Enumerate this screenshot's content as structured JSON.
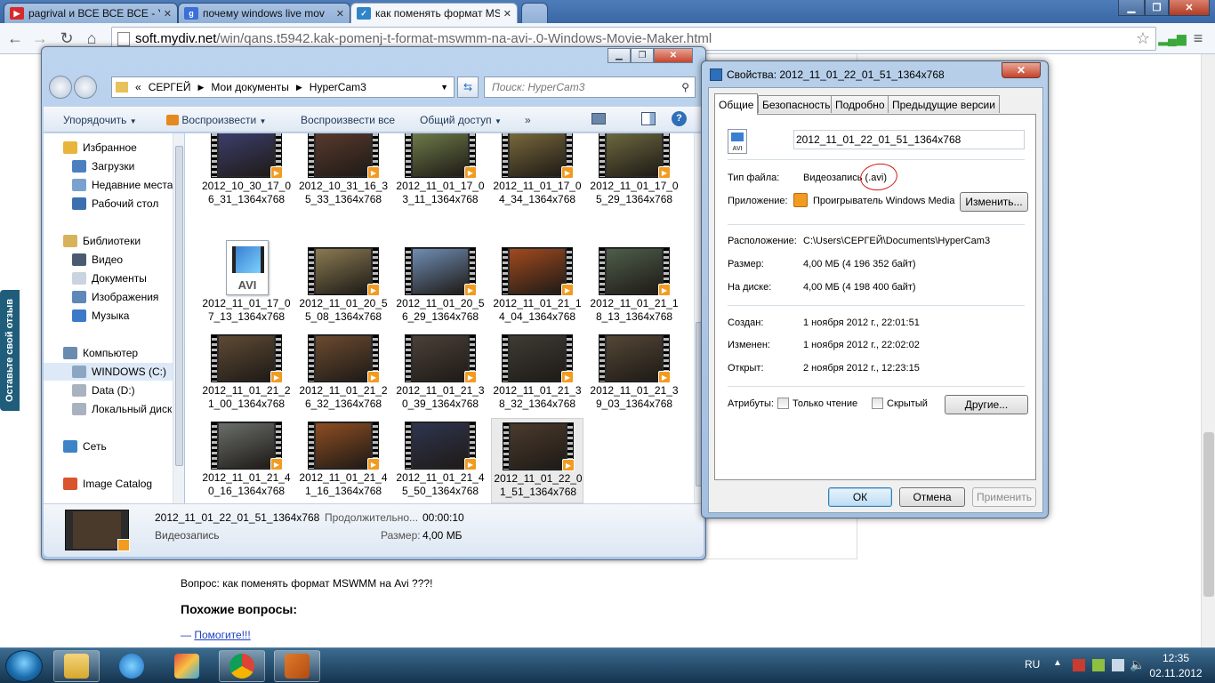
{
  "browser": {
    "tabs": [
      {
        "title": "pagrival и ВСЕ ВСЕ ВСЕ - Y",
        "icon": "youtube-icon"
      },
      {
        "title": "почему windows live mov",
        "icon": "google-icon"
      },
      {
        "title": "как поменять формат MS",
        "icon": "page-icon"
      }
    ],
    "url_host": "soft.mydiv.net",
    "url_path": "/win/qans.t5942.kak-pomenj-t-format-mswmm-na-avi-.0-Windows-Movie-Maker.html"
  },
  "webpage": {
    "feedback_tab": "Оставьте свой отзыв",
    "question": "Вопрос: как поменять формат MSWMM на Avi ???!",
    "similar_heading": "Похожие вопросы:",
    "similar_dash": "—",
    "similar_link": "Помогите!!!"
  },
  "explorer": {
    "breadcrumb": [
      "«",
      "СЕРГЕЙ",
      "Мои документы",
      "HyperCam3"
    ],
    "search_placeholder": "Поиск: HyperCam3",
    "commands": {
      "organize": "Упорядочить",
      "play": "Воспроизвести",
      "play_all": "Воспроизвести все",
      "share": "Общий доступ",
      "more": "»"
    },
    "nav": [
      {
        "label": "Избранное",
        "icon": "star-icon",
        "color": "#e8b43a",
        "level": 0
      },
      {
        "label": "Загрузки",
        "icon": "downloads-icon",
        "color": "#4b7fc0",
        "level": 1
      },
      {
        "label": "Недавние места",
        "icon": "recent-places-icon",
        "color": "#7aa2cf",
        "level": 1
      },
      {
        "label": "Рабочий стол",
        "icon": "desktop-icon",
        "color": "#3b6fb0",
        "level": 1
      },
      {
        "label": "Библиотеки",
        "icon": "libraries-icon",
        "color": "#d8b25a",
        "level": 0
      },
      {
        "label": "Видео",
        "icon": "video-library-icon",
        "color": "#4a5a70",
        "level": 1
      },
      {
        "label": "Документы",
        "icon": "documents-library-icon",
        "color": "#c9d4df",
        "level": 1
      },
      {
        "label": "Изображения",
        "icon": "pictures-library-icon",
        "color": "#5d88b8",
        "level": 1
      },
      {
        "label": "Музыка",
        "icon": "music-library-icon",
        "color": "#3c7ac9",
        "level": 1
      },
      {
        "label": "Компьютер",
        "icon": "computer-icon",
        "color": "#6a8bb0",
        "level": 0
      },
      {
        "label": "WINDOWS (C:)",
        "icon": "drive-c-icon",
        "color": "#8aa6c2",
        "level": 1,
        "selected": true
      },
      {
        "label": "Data (D:)",
        "icon": "drive-d-icon",
        "color": "#a9b3bd",
        "level": 1
      },
      {
        "label": "Локальный диск",
        "icon": "drive-local-icon",
        "color": "#a9b3bd",
        "level": 1
      },
      {
        "label": "Сеть",
        "icon": "network-icon",
        "color": "#3d84c6",
        "level": 0
      },
      {
        "label": "Image Catalog",
        "icon": "image-catalog-icon",
        "color": "#d9532c",
        "level": 0
      }
    ],
    "files": [
      {
        "name": "2012_10_30_17_06_31_1364x768",
        "tint": "#3d3f6e"
      },
      {
        "name": "2012_10_31_16_35_33_1364x768",
        "tint": "#5a3a2e"
      },
      {
        "name": "2012_11_01_17_03_11_1364x768",
        "tint": "#6f7d4a"
      },
      {
        "name": "2012_11_01_17_04_34_1364x768",
        "tint": "#7a6a3c"
      },
      {
        "name": "2012_11_01_17_05_29_1364x768",
        "tint": "#6e6a40"
      },
      {
        "name": "2012_11_01_17_07_13_1364x768",
        "tint": "",
        "avi": true,
        "avi_label": "AVI"
      },
      {
        "name": "2012_11_01_20_55_08_1364x768",
        "tint": "#8a7a52"
      },
      {
        "name": "2012_11_01_20_56_29_1364x768",
        "tint": "#6f8db4"
      },
      {
        "name": "2012_11_01_21_14_04_1364x768",
        "tint": "#a04a1e"
      },
      {
        "name": "2012_11_01_21_18_13_1364x768",
        "tint": "#4e5e4a"
      },
      {
        "name": "2012_11_01_21_21_00_1364x768",
        "tint": "#5e4a34"
      },
      {
        "name": "2012_11_01_21_26_32_1364x768",
        "tint": "#6b4a30"
      },
      {
        "name": "2012_11_01_21_30_39_1364x768",
        "tint": "#4a4038"
      },
      {
        "name": "2012_11_01_21_38_32_1364x768",
        "tint": "#3e3a34"
      },
      {
        "name": "2012_11_01_21_39_03_1364x768",
        "tint": "#534636"
      },
      {
        "name": "2012_11_01_21_40_16_1364x768",
        "tint": "#6a6e6a"
      },
      {
        "name": "2012_11_01_21_41_16_1364x768",
        "tint": "#8e4d22"
      },
      {
        "name": "2012_11_01_21_45_50_1364x768",
        "tint": "#2f3550"
      },
      {
        "name": "2012_11_01_22_01_51_1364x768",
        "tint": "#4a3a2c",
        "selected": true
      }
    ],
    "details": {
      "name": "2012_11_01_22_01_51_1364x768",
      "type": "Видеозапись",
      "duration_label": "Продолжительно...",
      "duration": "00:00:10",
      "size_label": "Размер:",
      "size": "4,00 МБ"
    }
  },
  "properties": {
    "title": "Свойства: 2012_11_01_22_01_51_1364x768",
    "tabs": [
      "Общие",
      "Безопасность",
      "Подробно",
      "Предыдущие версии"
    ],
    "filename": "2012_11_01_22_01_51_1364x768",
    "file_icon_label": "AVI",
    "type_label": "Тип файла:",
    "type_value": "Видеозапись (.avi)",
    "app_label": "Приложение:",
    "app_value": "Проигрыватель Windows Media",
    "change_button": "Изменить...",
    "location_label": "Расположение:",
    "location_value": "C:\\Users\\СЕРГЕЙ\\Documents\\HyperCam3",
    "size_label": "Размер:",
    "size_value": "4,00 МБ (4 196 352 байт)",
    "disk_label": "На диске:",
    "disk_value": "4,00 МБ (4 198 400 байт)",
    "created_label": "Создан:",
    "created_value": "1 ноября 2012 г., 22:01:51",
    "modified_label": "Изменен:",
    "modified_value": "1 ноября 2012 г., 22:02:02",
    "opened_label": "Открыт:",
    "opened_value": "2 ноября 2012 г., 12:23:15",
    "attributes_label": "Атрибуты:",
    "readonly_label": "Только чтение",
    "hidden_label": "Скрытый",
    "other_button": "Другие...",
    "ok": "ОК",
    "cancel": "Отмена",
    "apply": "Применить",
    "annotation_color": "#d01818"
  },
  "taskbar": {
    "lang": "RU",
    "time": "12:35",
    "date": "02.11.2012"
  }
}
